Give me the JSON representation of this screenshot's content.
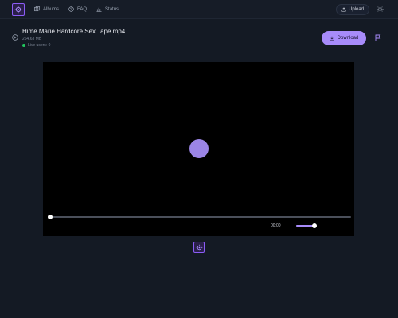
{
  "header": {
    "nav": [
      {
        "label": "Albums",
        "icon": "albums-icon"
      },
      {
        "label": "FAQ",
        "icon": "faq-icon"
      },
      {
        "label": "Status",
        "icon": "status-icon"
      }
    ],
    "upload_label": "Upload",
    "theme_icon": "sun-icon"
  },
  "file": {
    "title": "Hime Marie Hardcore Sex Tape.mp4",
    "size": "264.63 MB",
    "live_users": "Live users: 0",
    "download_label": "Download"
  },
  "player": {
    "time": "00:00",
    "progress": 0,
    "volume": 0.9
  },
  "colors": {
    "background": "#141a24",
    "accent": "#a78bfa",
    "live": "#22c55e"
  }
}
